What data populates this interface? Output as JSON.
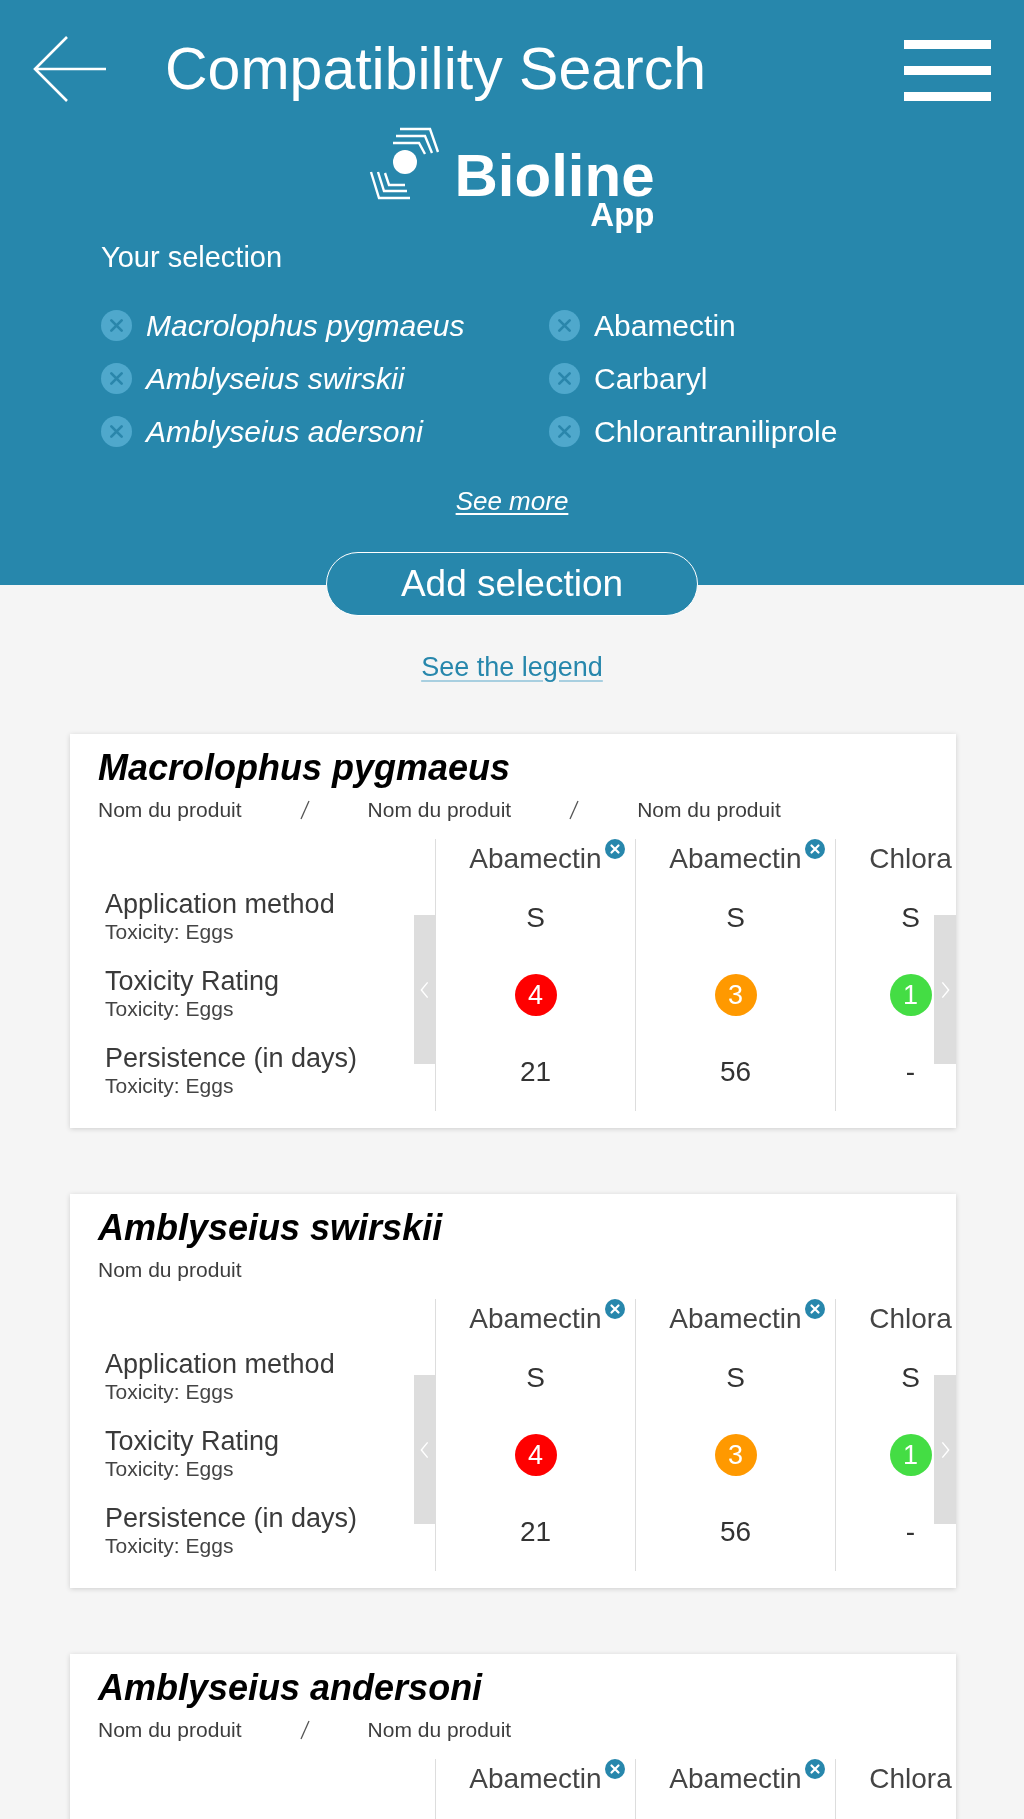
{
  "header": {
    "title": "Compatibility Search"
  },
  "logo": {
    "name": "Bioline",
    "subtitle": "App"
  },
  "selection": {
    "heading": "Your selection",
    "organisms": [
      "Macrolophus pygmaeus",
      "Amblyseius swirskii",
      "Amblyseius adersoni"
    ],
    "products": [
      "Abamectin",
      "Carbaryl",
      "Chlorantraniliprole"
    ],
    "see_more": "See more"
  },
  "add_button": "Add selection",
  "legend_link": "See the legend",
  "cards": [
    {
      "title": "Macrolophus pygmaeus",
      "products": [
        "Nom du produit",
        "Nom du produit",
        "Nom du produit"
      ],
      "columns": [
        {
          "name": "Abamectin",
          "removable": true
        },
        {
          "name": "Abamectin",
          "removable": true
        },
        {
          "name": "Chlora",
          "removable": false
        }
      ],
      "rows": [
        {
          "kind": "text",
          "label": "Application method",
          "sublabel": "Toxicity: Eggs",
          "cells": [
            "S",
            "S",
            "S"
          ]
        },
        {
          "kind": "rating",
          "label": "Toxicity Rating",
          "sublabel": "Toxicity: Eggs",
          "cells": [
            {
              "value": "4",
              "color": "#ff0000"
            },
            {
              "value": "3",
              "color": "#ff9900"
            },
            {
              "value": "1",
              "color": "#44dd44"
            }
          ]
        },
        {
          "kind": "text",
          "label": "Persistence (in days)",
          "sublabel": "Toxicity: Eggs",
          "cells": [
            "21",
            "56",
            "-"
          ]
        }
      ]
    },
    {
      "title": "Amblyseius swirskii",
      "products": [
        "Nom du produit"
      ],
      "columns": [
        {
          "name": "Abamectin",
          "removable": true
        },
        {
          "name": "Abamectin",
          "removable": true
        },
        {
          "name": "Chlora",
          "removable": false
        }
      ],
      "rows": [
        {
          "kind": "text",
          "label": "Application method",
          "sublabel": "Toxicity: Eggs",
          "cells": [
            "S",
            "S",
            "S"
          ]
        },
        {
          "kind": "rating",
          "label": "Toxicity Rating",
          "sublabel": "Toxicity: Eggs",
          "cells": [
            {
              "value": "4",
              "color": "#ff0000"
            },
            {
              "value": "3",
              "color": "#ff9900"
            },
            {
              "value": "1",
              "color": "#44dd44"
            }
          ]
        },
        {
          "kind": "text",
          "label": "Persistence (in days)",
          "sublabel": "Toxicity: Eggs",
          "cells": [
            "21",
            "56",
            "-"
          ]
        }
      ]
    },
    {
      "title": "Amblyseius andersoni",
      "products": [
        "Nom du produit",
        "Nom du produit"
      ],
      "columns": [
        {
          "name": "Abamectin",
          "removable": true
        },
        {
          "name": "Abamectin",
          "removable": true
        },
        {
          "name": "Chlora",
          "removable": false
        }
      ]
    }
  ]
}
